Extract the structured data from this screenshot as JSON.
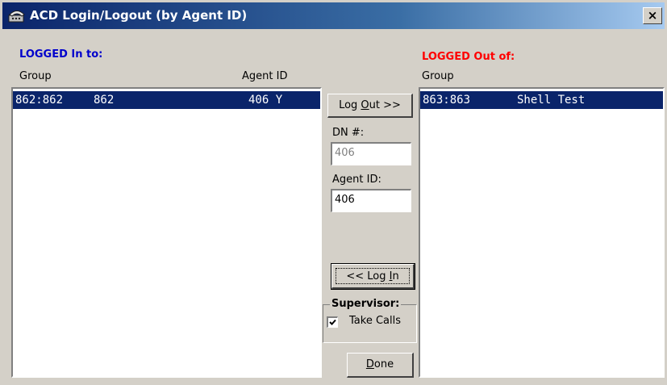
{
  "window": {
    "title": "ACD Login/Logout (by Agent ID)",
    "close_label": "×",
    "title_icon": "phone-icon"
  },
  "logged_in": {
    "heading": "LOGGED In to:",
    "heading_color": "#0000cc",
    "columns": {
      "group": "Group",
      "agent_id": "Agent ID"
    },
    "rows": [
      {
        "group": "862:862",
        "name": "862",
        "agent_id": "406 Y",
        "selected": true
      }
    ]
  },
  "logged_out": {
    "heading": "LOGGED Out of:",
    "heading_color": "#ff0000",
    "columns": {
      "group": "Group"
    },
    "rows": [
      {
        "group": "863:863",
        "name": "Shell Test",
        "selected": true
      }
    ]
  },
  "controls": {
    "logout_button": {
      "pre": "Log ",
      "accel": "O",
      "post": "ut >>"
    },
    "dn_label": "DN #:",
    "dn_value": "406",
    "agent_id_label": "Agent ID:",
    "agent_id_value": "406",
    "login_button": {
      "pre": "<< Log ",
      "accel": "I",
      "post": "n"
    },
    "supervisor_label": "Supervisor:",
    "take_calls_label": "Take Calls",
    "take_calls_checked": true,
    "done_button": {
      "pre": "",
      "accel": "D",
      "post": "one"
    }
  },
  "colors": {
    "face": "#d4d0c8",
    "selection": "#0a246a",
    "titlebar_start": "#0a246a"
  }
}
